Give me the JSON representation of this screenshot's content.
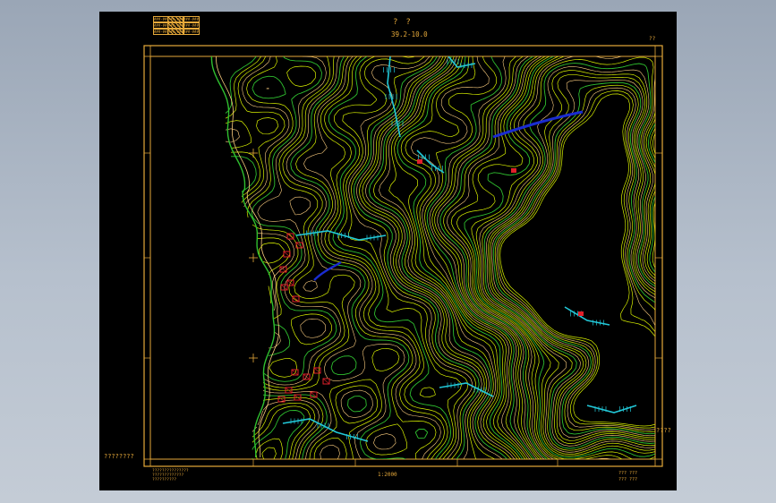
{
  "map": {
    "title": "?　?",
    "sheet_number": "39.2-10.0",
    "scale": "1:2000",
    "left_margin_note": "????????",
    "right_margin_note": "????",
    "top_right_mark": "??",
    "legend_cells": [
      "###-###",
      "###-###",
      "###-###",
      "###-###",
      "###-###",
      "###-###"
    ],
    "bottom_notes": [
      "???????????????",
      "?????????????",
      "??????????"
    ],
    "bottom_right_notes": [
      "???  ???",
      "???  ???"
    ],
    "colors": {
      "frame": "#e6a93a",
      "contour_yellow": "#d8f000",
      "contour_green": "#2fbf2f",
      "water": "#22c8d8",
      "river": "#1a2cd0",
      "building": "#e0202a",
      "road": "#ffd080"
    }
  }
}
